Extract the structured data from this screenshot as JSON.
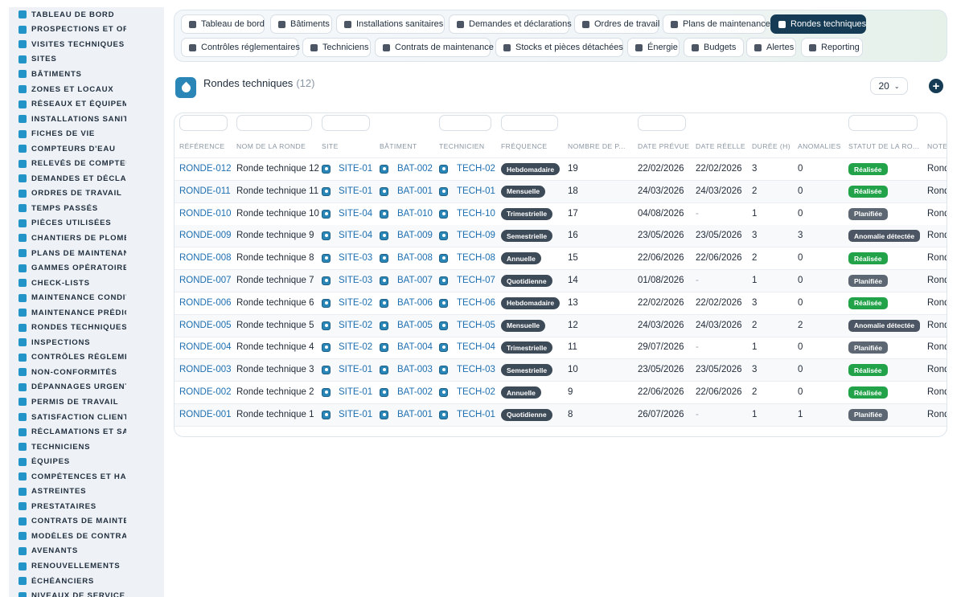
{
  "sidebar": {
    "items": [
      {
        "label": "TABLEAU DE BORD",
        "icon": "dashboard-icon"
      },
      {
        "label": "PROSPECTIONS ET OPPO",
        "icon": "target-icon"
      },
      {
        "label": "VISITES TECHNIQUES ET",
        "icon": "clipboard-icon"
      },
      {
        "label": "SITES",
        "icon": "map-pin-icon"
      },
      {
        "label": "BÂTIMENTS",
        "icon": "building-icon"
      },
      {
        "label": "ZONES ET LOCAUX",
        "icon": "grid-icon"
      },
      {
        "label": "RÉSEAUX ET ÉQUIPEMEN",
        "icon": "network-icon"
      },
      {
        "label": "INSTALLATIONS SANITAI",
        "icon": "faucet-icon"
      },
      {
        "label": "FICHES DE VIE",
        "icon": "history-icon"
      },
      {
        "label": "COMPTEURS D'EAU",
        "icon": "gauge-icon"
      },
      {
        "label": "RELEVÉS DE COMPTEURS",
        "icon": "chart-icon"
      },
      {
        "label": "DEMANDES ET DÉCLARA",
        "icon": "question-icon"
      },
      {
        "label": "ORDRES DE TRAVAIL",
        "icon": "clipboard-list-icon"
      },
      {
        "label": "TEMPS PASSÉS",
        "icon": "clock-icon"
      },
      {
        "label": "PIÈCES UTILISÉES",
        "icon": "boxes-icon"
      },
      {
        "label": "CHANTIERS DE PLOMBER",
        "icon": "wrench-icon"
      },
      {
        "label": "PLANS DE MAINTENANCE",
        "icon": "calendar-icon"
      },
      {
        "label": "GAMMES OPÉRATOIRES",
        "icon": "list-icon"
      },
      {
        "label": "CHECK-LISTS",
        "icon": "checklist-icon"
      },
      {
        "label": "MAINTENANCE CONDITIO",
        "icon": "thermometer-icon"
      },
      {
        "label": "MAINTENANCE PRÉDICTI",
        "icon": "trend-icon"
      },
      {
        "label": "RONDES TECHNIQUES",
        "icon": "route-icon"
      },
      {
        "label": "INSPECTIONS",
        "icon": "magnifier-icon"
      },
      {
        "label": "CONTRÔLES RÉGLEMENT",
        "icon": "check-shield-icon"
      },
      {
        "label": "NON-CONFORMITÉS",
        "icon": "alert-circle-icon"
      },
      {
        "label": "DÉPANNAGES URGENTS",
        "icon": "warning-icon"
      },
      {
        "label": "PERMIS DE TRAVAIL",
        "icon": "id-card-icon"
      },
      {
        "label": "SATISFACTION CLIENT",
        "icon": "smile-icon"
      },
      {
        "label": "RÉCLAMATIONS ET SAV",
        "icon": "comment-icon"
      },
      {
        "label": "TECHNICIENS",
        "icon": "hard-hat-icon"
      },
      {
        "label": "ÉQUIPES",
        "icon": "users-icon"
      },
      {
        "label": "COMPÉTENCES ET HABIL",
        "icon": "certificate-icon"
      },
      {
        "label": "ASTREINTES",
        "icon": "phone-icon"
      },
      {
        "label": "PRESTATAIRES",
        "icon": "handshake-icon"
      },
      {
        "label": "CONTRATS DE MAINTENA",
        "icon": "document-icon"
      },
      {
        "label": "MODÈLES DE CONTRATS",
        "icon": "file-template-icon"
      },
      {
        "label": "AVENANTS",
        "icon": "file-edit-icon"
      },
      {
        "label": "RENOUVELLEMENTS",
        "icon": "refresh-icon"
      },
      {
        "label": "ÉCHÉANCIERS",
        "icon": "file-clock-icon"
      },
      {
        "label": "NIVEAUX DE SERVICE (SL",
        "icon": "award-icon"
      }
    ]
  },
  "tabs": [
    {
      "label": "Tableau de bord",
      "icon": "dashboard-icon",
      "active": false
    },
    {
      "label": "Bâtiments",
      "icon": "building-icon",
      "active": false
    },
    {
      "label": "Installations sanitaires",
      "icon": "gears-icon",
      "active": false
    },
    {
      "label": "Demandes et déclarations",
      "icon": "question-icon",
      "active": false
    },
    {
      "label": "Ordres de travail",
      "icon": "clipboard-icon",
      "active": false
    },
    {
      "label": "Plans de maintenance",
      "icon": "calendar-icon",
      "active": false
    },
    {
      "label": "Rondes techniques",
      "icon": "route-icon",
      "active": true
    },
    {
      "label": "Contrôles réglementaires",
      "icon": "clipboard-check-icon",
      "active": false
    },
    {
      "label": "Techniciens",
      "icon": "hard-hat-icon",
      "active": false
    },
    {
      "label": "Contrats de maintenance",
      "icon": "document-icon",
      "active": false
    },
    {
      "label": "Stocks et pièces détachées",
      "icon": "boxes-icon",
      "active": false
    },
    {
      "label": "Énergie",
      "icon": "bolt-icon",
      "active": false
    },
    {
      "label": "Budgets",
      "icon": "money-icon",
      "active": false
    },
    {
      "label": "Alertes",
      "icon": "bell-icon",
      "active": false
    },
    {
      "label": "Reporting",
      "icon": "pie-chart-icon",
      "active": false
    }
  ],
  "header": {
    "title": "Rondes techniques",
    "count": "(12)",
    "page_size": "20",
    "page_size_chevron": "⌄",
    "add_label": "+"
  },
  "table": {
    "columns": [
      "RÉFÉRENCE",
      "NOM DE LA RONDE",
      "SITE",
      "BÂTIMENT",
      "TECHNICIEN",
      "FRÉQUENCE",
      "NOMBRE DE P...",
      "DATE PRÉVUE",
      "DATE RÉELLE",
      "DURÉE (H)",
      "ANOMALIES",
      "STATUT DE LA RO...",
      "NOTE"
    ],
    "rows": [
      {
        "ref": "RONDE-012",
        "name": "Ronde technique 12",
        "site": "SITE-01",
        "batiment": "BAT-002",
        "tech": "TECH-02",
        "freq": "Hebdomadaire",
        "points": "19",
        "prevue": "22/02/2026",
        "reelle": "22/02/2026",
        "duree": "3",
        "anomalies": "0",
        "statut": "Réalisée",
        "statut_kind": "realisee",
        "note": "Ronde"
      },
      {
        "ref": "RONDE-011",
        "name": "Ronde technique 11",
        "site": "SITE-01",
        "batiment": "BAT-001",
        "tech": "TECH-01",
        "freq": "Mensuelle",
        "points": "18",
        "prevue": "24/03/2026",
        "reelle": "24/03/2026",
        "duree": "2",
        "anomalies": "0",
        "statut": "Réalisée",
        "statut_kind": "realisee",
        "note": "Ronde"
      },
      {
        "ref": "RONDE-010",
        "name": "Ronde technique 10",
        "site": "SITE-04",
        "batiment": "BAT-010",
        "tech": "TECH-10",
        "freq": "Trimestrielle",
        "points": "17",
        "prevue": "04/08/2026",
        "reelle": "-",
        "duree": "1",
        "anomalies": "0",
        "statut": "Planifiée",
        "statut_kind": "planifiee",
        "note": "Ronde"
      },
      {
        "ref": "RONDE-009",
        "name": "Ronde technique 9",
        "site": "SITE-04",
        "batiment": "BAT-009",
        "tech": "TECH-09",
        "freq": "Semestrielle",
        "points": "16",
        "prevue": "23/05/2026",
        "reelle": "23/05/2026",
        "duree": "3",
        "anomalies": "3",
        "statut": "Anomalie détectée",
        "statut_kind": "anomalie",
        "note": "Ronde"
      },
      {
        "ref": "RONDE-008",
        "name": "Ronde technique 8",
        "site": "SITE-03",
        "batiment": "BAT-008",
        "tech": "TECH-08",
        "freq": "Annuelle",
        "points": "15",
        "prevue": "22/06/2026",
        "reelle": "22/06/2026",
        "duree": "2",
        "anomalies": "0",
        "statut": "Réalisée",
        "statut_kind": "realisee",
        "note": "Ronde"
      },
      {
        "ref": "RONDE-007",
        "name": "Ronde technique 7",
        "site": "SITE-03",
        "batiment": "BAT-007",
        "tech": "TECH-07",
        "freq": "Quotidienne",
        "points": "14",
        "prevue": "01/08/2026",
        "reelle": "-",
        "duree": "1",
        "anomalies": "0",
        "statut": "Planifiée",
        "statut_kind": "planifiee",
        "note": "Ronde"
      },
      {
        "ref": "RONDE-006",
        "name": "Ronde technique 6",
        "site": "SITE-02",
        "batiment": "BAT-006",
        "tech": "TECH-06",
        "freq": "Hebdomadaire",
        "points": "13",
        "prevue": "22/02/2026",
        "reelle": "22/02/2026",
        "duree": "3",
        "anomalies": "0",
        "statut": "Réalisée",
        "statut_kind": "realisee",
        "note": "Ronde"
      },
      {
        "ref": "RONDE-005",
        "name": "Ronde technique 5",
        "site": "SITE-02",
        "batiment": "BAT-005",
        "tech": "TECH-05",
        "freq": "Mensuelle",
        "points": "12",
        "prevue": "24/03/2026",
        "reelle": "24/03/2026",
        "duree": "2",
        "anomalies": "2",
        "statut": "Anomalie détectée",
        "statut_kind": "anomalie",
        "note": "Ronde"
      },
      {
        "ref": "RONDE-004",
        "name": "Ronde technique 4",
        "site": "SITE-02",
        "batiment": "BAT-004",
        "tech": "TECH-04",
        "freq": "Trimestrielle",
        "points": "11",
        "prevue": "29/07/2026",
        "reelle": "-",
        "duree": "1",
        "anomalies": "0",
        "statut": "Planifiée",
        "statut_kind": "planifiee",
        "note": "Ronde"
      },
      {
        "ref": "RONDE-003",
        "name": "Ronde technique 3",
        "site": "SITE-01",
        "batiment": "BAT-003",
        "tech": "TECH-03",
        "freq": "Semestrielle",
        "points": "10",
        "prevue": "23/05/2026",
        "reelle": "23/05/2026",
        "duree": "3",
        "anomalies": "0",
        "statut": "Réalisée",
        "statut_kind": "realisee",
        "note": "Ronde"
      },
      {
        "ref": "RONDE-002",
        "name": "Ronde technique 2",
        "site": "SITE-01",
        "batiment": "BAT-002",
        "tech": "TECH-02",
        "freq": "Annuelle",
        "points": "9",
        "prevue": "22/06/2026",
        "reelle": "22/06/2026",
        "duree": "2",
        "anomalies": "0",
        "statut": "Réalisée",
        "statut_kind": "realisee",
        "note": "Ronde"
      },
      {
        "ref": "RONDE-001",
        "name": "Ronde technique 1",
        "site": "SITE-01",
        "batiment": "BAT-001",
        "tech": "TECH-01",
        "freq": "Quotidienne",
        "points": "8",
        "prevue": "26/07/2026",
        "reelle": "-",
        "duree": "1",
        "anomalies": "1",
        "statut": "Planifiée",
        "statut_kind": "planifiee",
        "note": "Ronde"
      }
    ]
  },
  "colors": {
    "accent": "#163c55",
    "link": "#1e6fb0",
    "sidebar_icon": "#2394c8",
    "status_realisee": "#22a34a",
    "status_planifiee": "#5c6773",
    "status_anomalie": "#4b5563",
    "frequency_pill": "#3d4a58"
  }
}
